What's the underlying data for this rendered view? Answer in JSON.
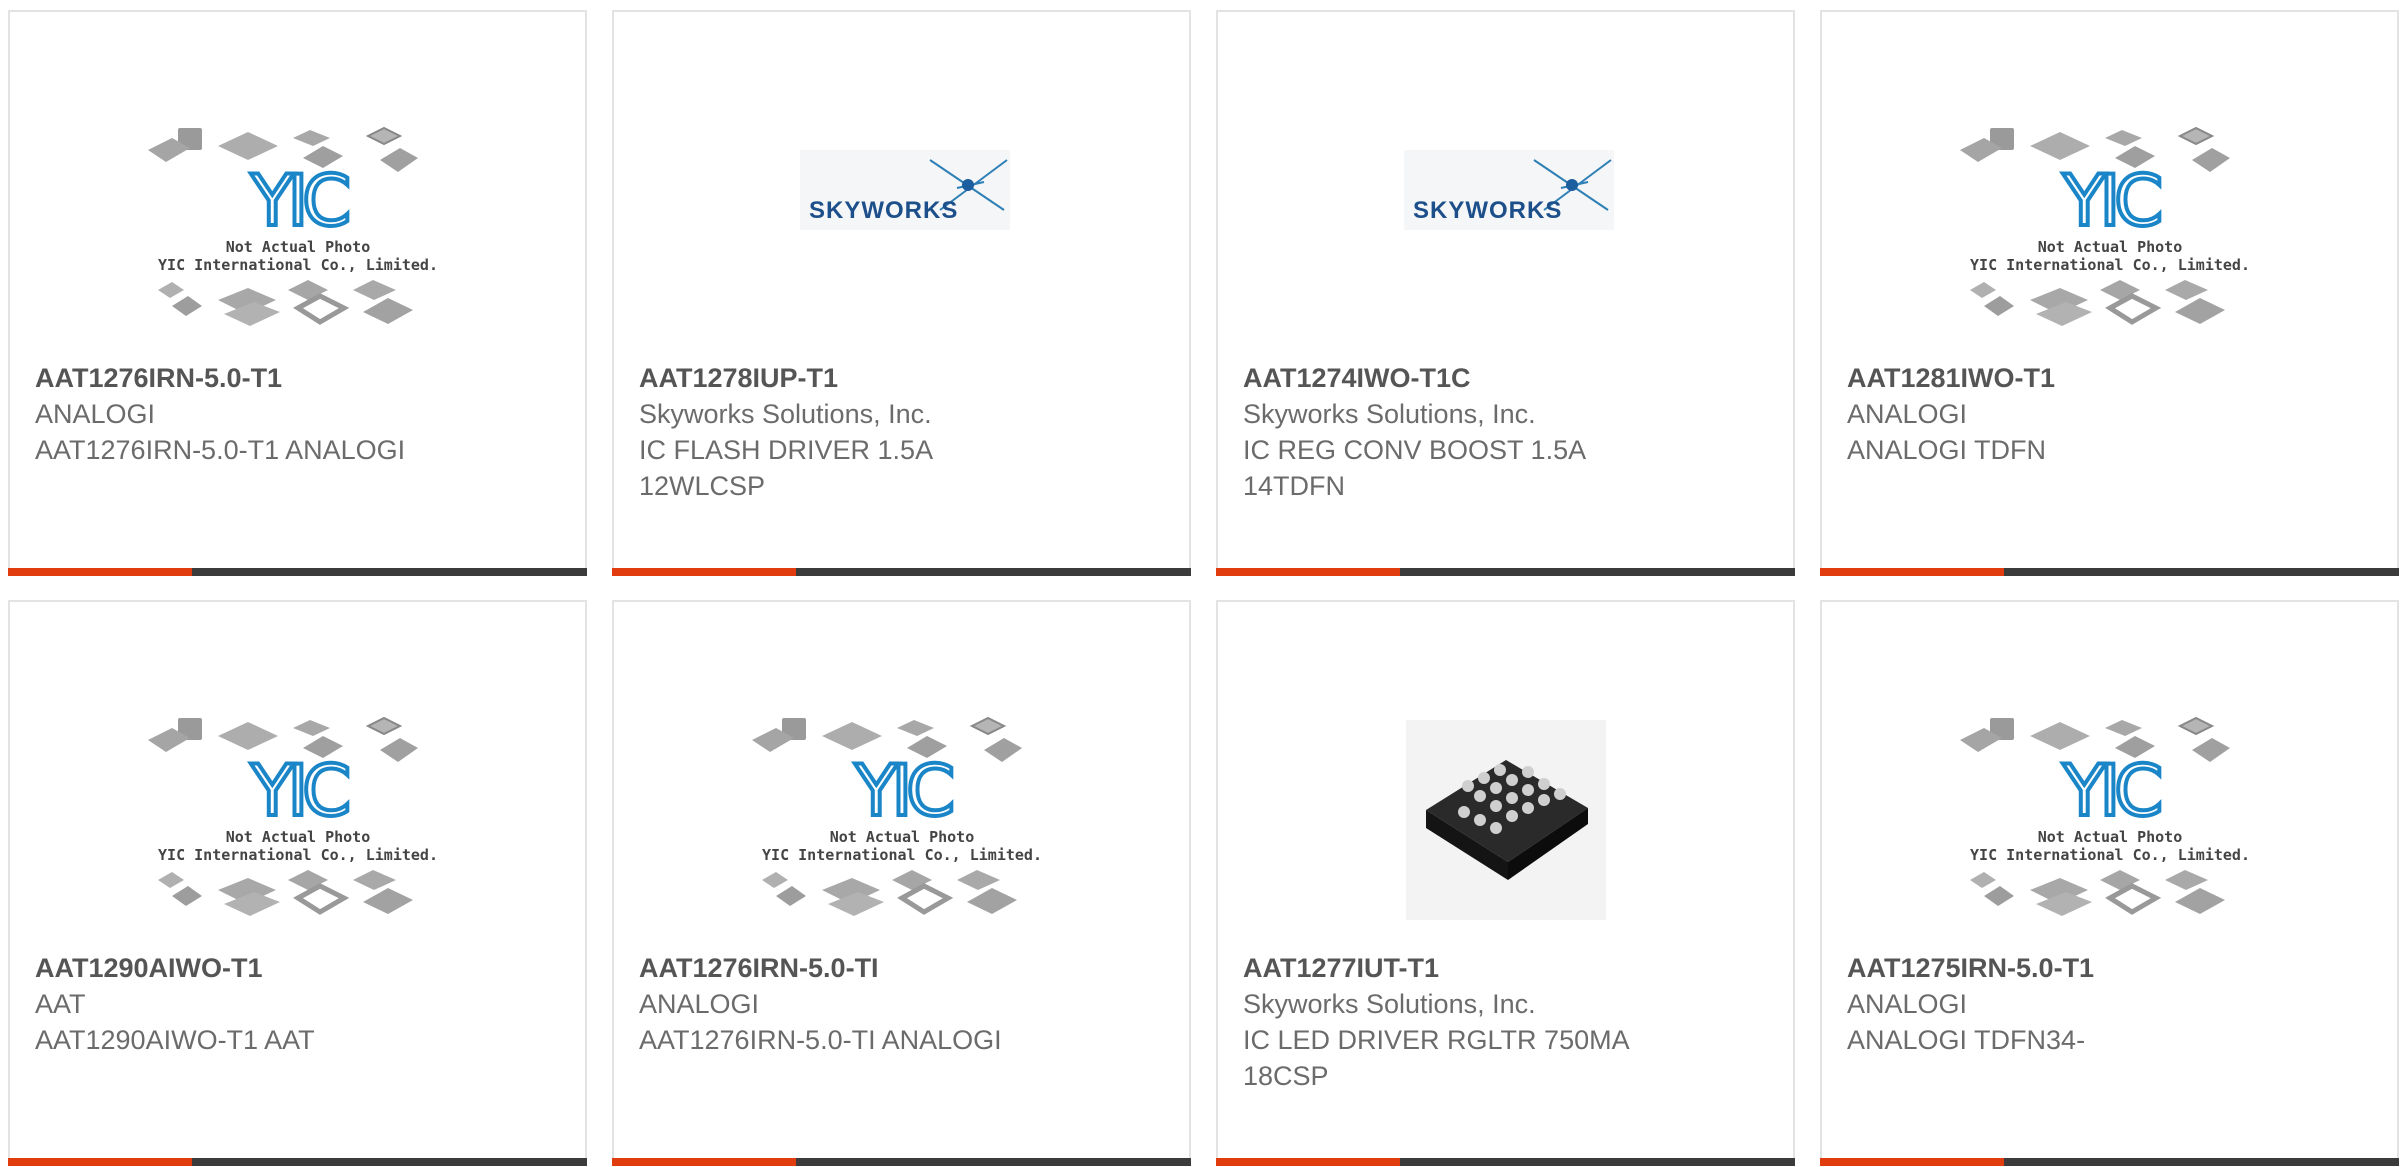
{
  "colors": {
    "accent": "#e03c0e",
    "bar": "#3b3b3b",
    "brand_blue": "#1a86c8"
  },
  "placeholder_image": {
    "line1": "Not Actual Photo",
    "line2": "YIC International Co., Limited.",
    "logo": "YIC"
  },
  "skyworks_logo": {
    "text": "SKYWORKS"
  },
  "products": [
    {
      "part": "AAT1276IRN-5.0-T1",
      "mfr": "ANALOGI",
      "desc": "AAT1276IRN-5.0-T1 ANALOGI",
      "image": "yic-placeholder"
    },
    {
      "part": "AAT1278IUP-T1",
      "mfr": "Skyworks Solutions, Inc.",
      "desc": "IC FLASH DRIVER 1.5A 12WLCSP",
      "image": "skyworks-logo"
    },
    {
      "part": "AAT1274IWO-T1C",
      "mfr": "Skyworks Solutions, Inc.",
      "desc": "IC REG CONV BOOST 1.5A 14TDFN",
      "image": "skyworks-logo"
    },
    {
      "part": "AAT1281IWO-T1",
      "mfr": "ANALOGI",
      "desc": "ANALOGI TDFN",
      "image": "yic-placeholder"
    },
    {
      "part": "AAT1290AIWO-T1",
      "mfr": "AAT",
      "desc": "AAT1290AIWO-T1 AAT",
      "image": "yic-placeholder"
    },
    {
      "part": "AAT1276IRN-5.0-TI",
      "mfr": "ANALOGI",
      "desc": "AAT1276IRN-5.0-TI ANALOGI",
      "image": "yic-placeholder"
    },
    {
      "part": "AAT1277IUT-T1",
      "mfr": "Skyworks Solutions, Inc.",
      "desc": "IC LED DRIVER RGLTR 750MA 18CSP",
      "image": "chip-photo"
    },
    {
      "part": "AAT1275IRN-5.0-T1",
      "mfr": "ANALOGI",
      "desc": "ANALOGI TDFN34-",
      "image": "yic-placeholder"
    }
  ]
}
